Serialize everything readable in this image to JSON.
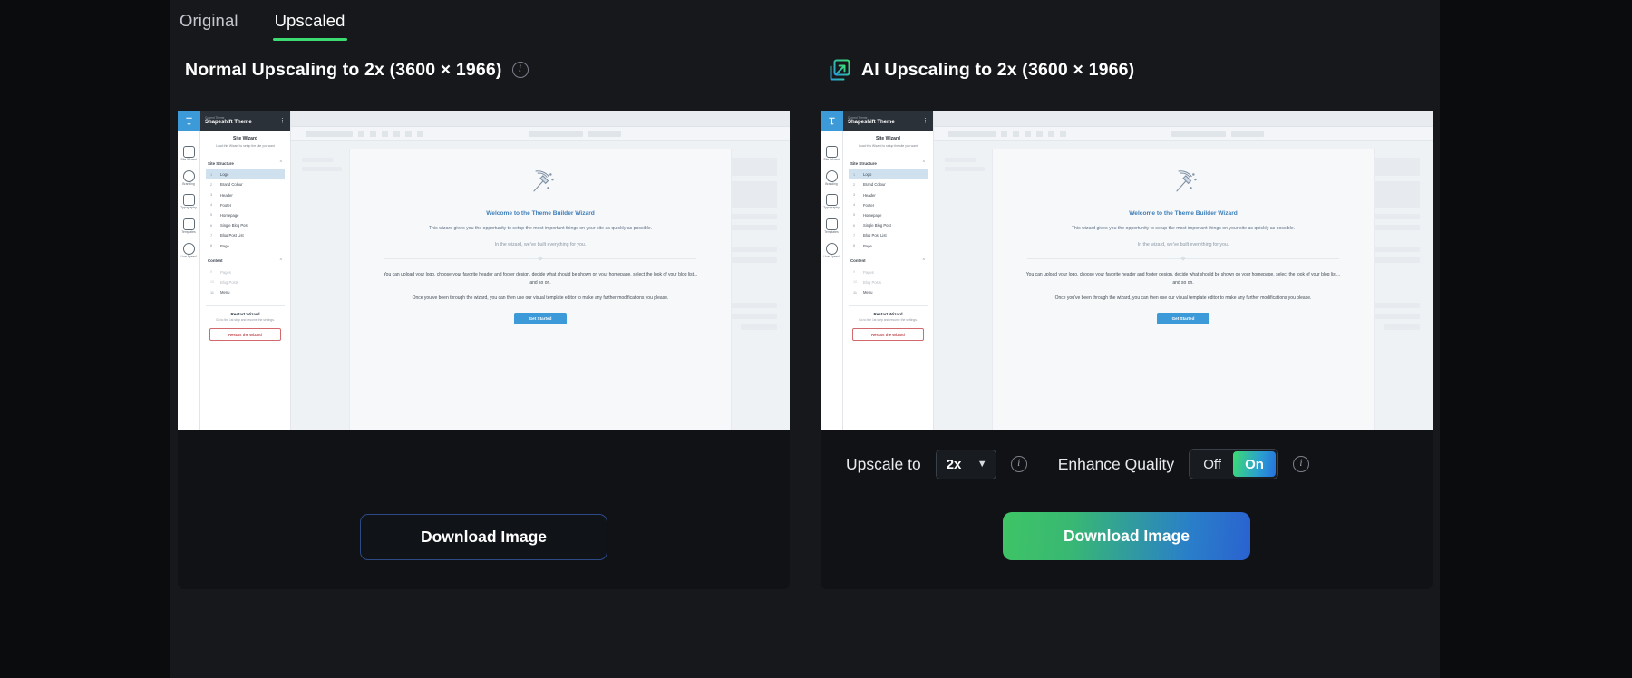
{
  "tabs": [
    {
      "label": "Original",
      "active": false
    },
    {
      "label": "Upscaled",
      "active": true
    }
  ],
  "accent": {
    "green": "#3ddc73",
    "blue": "#2a62d0",
    "outline_blue": "#2d4a86"
  },
  "panels": {
    "normal": {
      "title": "Normal Upscaling to 2x (3600 × 1966)",
      "info_icon": "info-icon",
      "download_label": "Download Image"
    },
    "ai": {
      "badge_icon": "ai-upscale-icon",
      "title": "AI Upscaling to 2x (3600 × 1966)",
      "download_label": "Download Image",
      "controls": {
        "upscale_label": "Upscale to",
        "upscale_value": "2x",
        "upscale_info_icon": "info-icon",
        "enhance_label": "Enhance Quality",
        "enhance_options": [
          "Off",
          "On"
        ],
        "enhance_selected": "On",
        "enhance_info_icon": "info-icon"
      }
    }
  },
  "preview": {
    "app": {
      "brand_small": "Current Theme",
      "brand": "Shapeshift Theme",
      "menu_icon": "kebab-menu-icon",
      "logo_icon": "theme-logo-icon"
    },
    "rail": [
      {
        "icon": "wand-icon",
        "label": "Site Wizard"
      },
      {
        "icon": "droplet-icon",
        "label": "Branding"
      },
      {
        "icon": "type-icon",
        "label": "Typography"
      },
      {
        "icon": "template-icon",
        "label": "Templates"
      },
      {
        "icon": "eye-icon",
        "label": "Live Speed"
      }
    ],
    "wizard_title": "Site Wizard",
    "wizard_sub": "Load this Wizard to setup the site you want",
    "groups": [
      {
        "heading": "Site Structure",
        "chevron": "chevron-up-icon",
        "items": [
          {
            "num": "1",
            "label": "Logo",
            "selected": true
          },
          {
            "num": "2",
            "label": "Brand Colour",
            "selected": false
          },
          {
            "num": "3",
            "label": "Header",
            "selected": false
          },
          {
            "num": "4",
            "label": "Footer",
            "selected": false
          },
          {
            "num": "5",
            "label": "Homepage",
            "selected": false
          },
          {
            "num": "6",
            "label": "Single Blog Post",
            "selected": false
          },
          {
            "num": "7",
            "label": "Blog Post List",
            "selected": false
          },
          {
            "num": "8",
            "label": "Page",
            "selected": false
          }
        ]
      },
      {
        "heading": "Content",
        "chevron": "chevron-up-icon",
        "items": [
          {
            "num": "9",
            "label": "Pages",
            "dim": true
          },
          {
            "num": "10",
            "label": "Blog Posts",
            "dim": true
          },
          {
            "num": "11",
            "label": "Menu",
            "dim": false
          }
        ]
      }
    ],
    "restart": {
      "title": "Restart Wizard",
      "subtitle": "Go to the 1st step and resume the settings.",
      "button": "Restart the Wizard"
    },
    "sheet": {
      "wand_icon": "magic-wand-icon",
      "heading": "Welcome to the Theme Builder Wizard",
      "para1": "This wizard gives you the opportunity to setup the most important things on your site as quickly as possible.",
      "para2": "In the wizard, we've built everything for you.",
      "sparkle_icon": "sparkle-icon",
      "para3": "You can upload your logo, choose your favorite header and footer design, decide what should be shown on your homepage, select the look of your blog list... and so on.",
      "para4": "Once you've been through the wizard, you can then use our visual template editor to make any further modifications you please.",
      "cta": "Get Started"
    }
  }
}
